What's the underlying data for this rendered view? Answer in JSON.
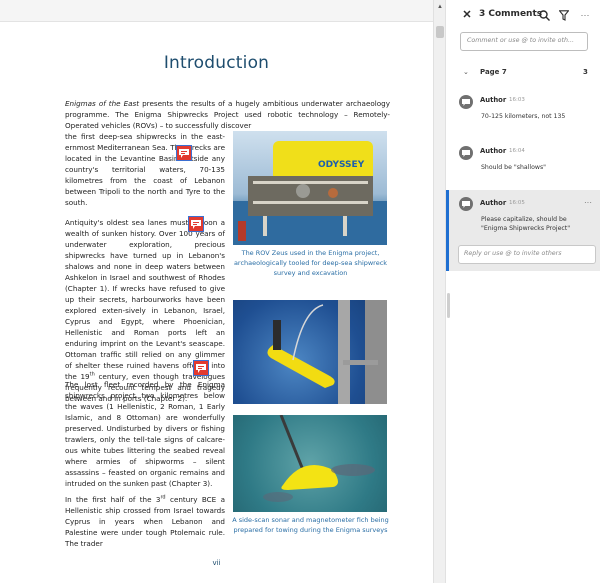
{
  "document": {
    "page_title": "Introduction",
    "paragraphs": {
      "p1_italic": "Enigmas of the East",
      "p1_rest": " presents the results of a hugely ambitious underwater archaeology programme. The Enigma Shipwrecks Project used robotic technology – Remotely-Operated vehicles (ROVs) – to successfully discover",
      "p1_narrow": "the first deep-sea shipwrecks in the east-ernmost Mediterranean Sea. The wrecks are located in the Levantine Basin outside any country's territorial waters, 70-135 kilometres from the coast of Lebanon between Tripoli to the north and Tyre to the south.",
      "p2_a": "Antiquity's oldest sea lanes must cocoon a wealth of sunken history. Over 100 years of underwater exploration, precious shipwrecks have turned up in Lebanon's shalows and none in deep waters between Ashkelon in Israel and southwest of Rhodes (Chapter 1). If wrecks have refused to give up their secrets, harbourworks have been explored exten-sively in Lebanon, Israel, Cyprus and Egypt, where Phoenician, Hellenistic and Roman ports left an enduring imprint on the Levant's seascape. Ottoman traffic still relied on any glimmer of shelter these ruined havens offered into the 19",
      "p2_sup": "th",
      "p2_b": " century, even though travelogues frequently recount tempest and tragedy between and in ports (Chapter 2).",
      "p3": "The lost fleet recorded by the Enigma shipwrecks project two kilometres below the waves (1 Hellenistic, 2 Roman, 1 Early Islamic, and 8 Ottoman) are wonderfully preserved. Undisturbed by divers or fishing trawlers, only the tell-tale signs of calcare-ous white tubes littering the seabed reveal where armies of shipworms – silent assassins – feasted on organic remains and intruded on the sunken past (Chapter 3).",
      "p4_a": "In the first half of the 3",
      "p4_sup": "rd",
      "p4_b": " century BCE a Hellenistic ship crossed from Israel towards Cyprus in years when Lebanon and Palestine were under tough Ptolemaic rule. The trader"
    },
    "captions": {
      "fig1": "The ROV Zeus used in the Enigma project, archaeologically tooled for deep-sea shipwreck survey and excavation",
      "fig3": "A side-scan sonar and magnetometer fich being prepared for towing during the Enigma surveys"
    },
    "figure_labels": {
      "rov_brand": "ODYSSEY"
    },
    "folio": "vii"
  },
  "scrollbar": {
    "up_arrow": "▲"
  },
  "comments_panel": {
    "close_glyph": "✕",
    "title": "3 Comments",
    "more_glyph": "···",
    "input_placeholder": "Comment or use @ to invite oth...",
    "page_group": {
      "chevron": "⌄",
      "label": "Page 7",
      "count": "3"
    },
    "comments": [
      {
        "author": "Author",
        "time": "16:03",
        "text": "70-125 kilometers, not 135"
      },
      {
        "author": "Author",
        "time": "16:04",
        "text": "Should be \"shallows\""
      },
      {
        "author": "Author",
        "time": "16:05",
        "text": "Please capitalize, should be \"Enigma Shipwrecks Project\"",
        "more": "···",
        "reply_placeholder": "Reply or use @ to invite others"
      }
    ],
    "colors": {
      "accent": "#1f6fd1",
      "marker": "#e23a2f"
    }
  }
}
